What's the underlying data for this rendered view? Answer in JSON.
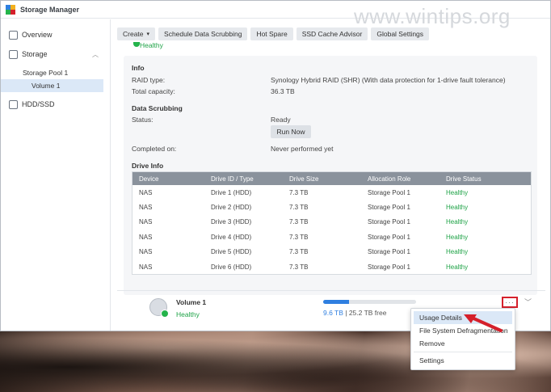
{
  "window": {
    "title": "Storage Manager"
  },
  "watermark": "www.wintips.org",
  "sidebar": {
    "overview": "Overview",
    "storage": "Storage",
    "pool": "Storage Pool 1",
    "volume": "Volume 1",
    "hdd": "HDD/SSD"
  },
  "toolbar": {
    "create": "Create",
    "scrub": "Schedule Data Scrubbing",
    "hotspare": "Hot Spare",
    "ssd": "SSD Cache Advisor",
    "global": "Global Settings"
  },
  "pool_status": "Healthy",
  "info": {
    "heading": "Info",
    "raid_label": "RAID type:",
    "raid_value": "Synology Hybrid RAID (SHR) (With data protection for 1-drive fault tolerance)",
    "capacity_label": "Total capacity:",
    "capacity_value": "36.3 TB"
  },
  "scrubbing": {
    "heading": "Data Scrubbing",
    "status_label": "Status:",
    "status_value": "Ready",
    "run_now": "Run Now",
    "completed_label": "Completed on:",
    "completed_value": "Never performed yet"
  },
  "drives": {
    "heading": "Drive Info",
    "columns": [
      "Device",
      "Drive ID / Type",
      "Drive Size",
      "Allocation Role",
      "Drive Status"
    ],
    "rows": [
      [
        "NAS",
        "Drive 1 (HDD)",
        "7.3 TB",
        "Storage Pool 1",
        "Healthy"
      ],
      [
        "NAS",
        "Drive 2 (HDD)",
        "7.3 TB",
        "Storage Pool 1",
        "Healthy"
      ],
      [
        "NAS",
        "Drive 3 (HDD)",
        "7.3 TB",
        "Storage Pool 1",
        "Healthy"
      ],
      [
        "NAS",
        "Drive 4 (HDD)",
        "7.3 TB",
        "Storage Pool 1",
        "Healthy"
      ],
      [
        "NAS",
        "Drive 5 (HDD)",
        "7.3 TB",
        "Storage Pool 1",
        "Healthy"
      ],
      [
        "NAS",
        "Drive 6 (HDD)",
        "7.3 TB",
        "Storage Pool 1",
        "Healthy"
      ]
    ]
  },
  "volume": {
    "name": "Volume 1",
    "status": "Healthy",
    "used": "9.6 TB",
    "sep": " | ",
    "free": "25.2 TB free",
    "used_fraction": 0.28,
    "more": "···"
  },
  "menu": {
    "items": [
      "Usage Details",
      "File System Defragmentation",
      "Remove",
      "Settings"
    ]
  },
  "colors": {
    "accent": "#2f7fe0",
    "healthy": "#1fa347",
    "highlight": "#d5202b"
  }
}
